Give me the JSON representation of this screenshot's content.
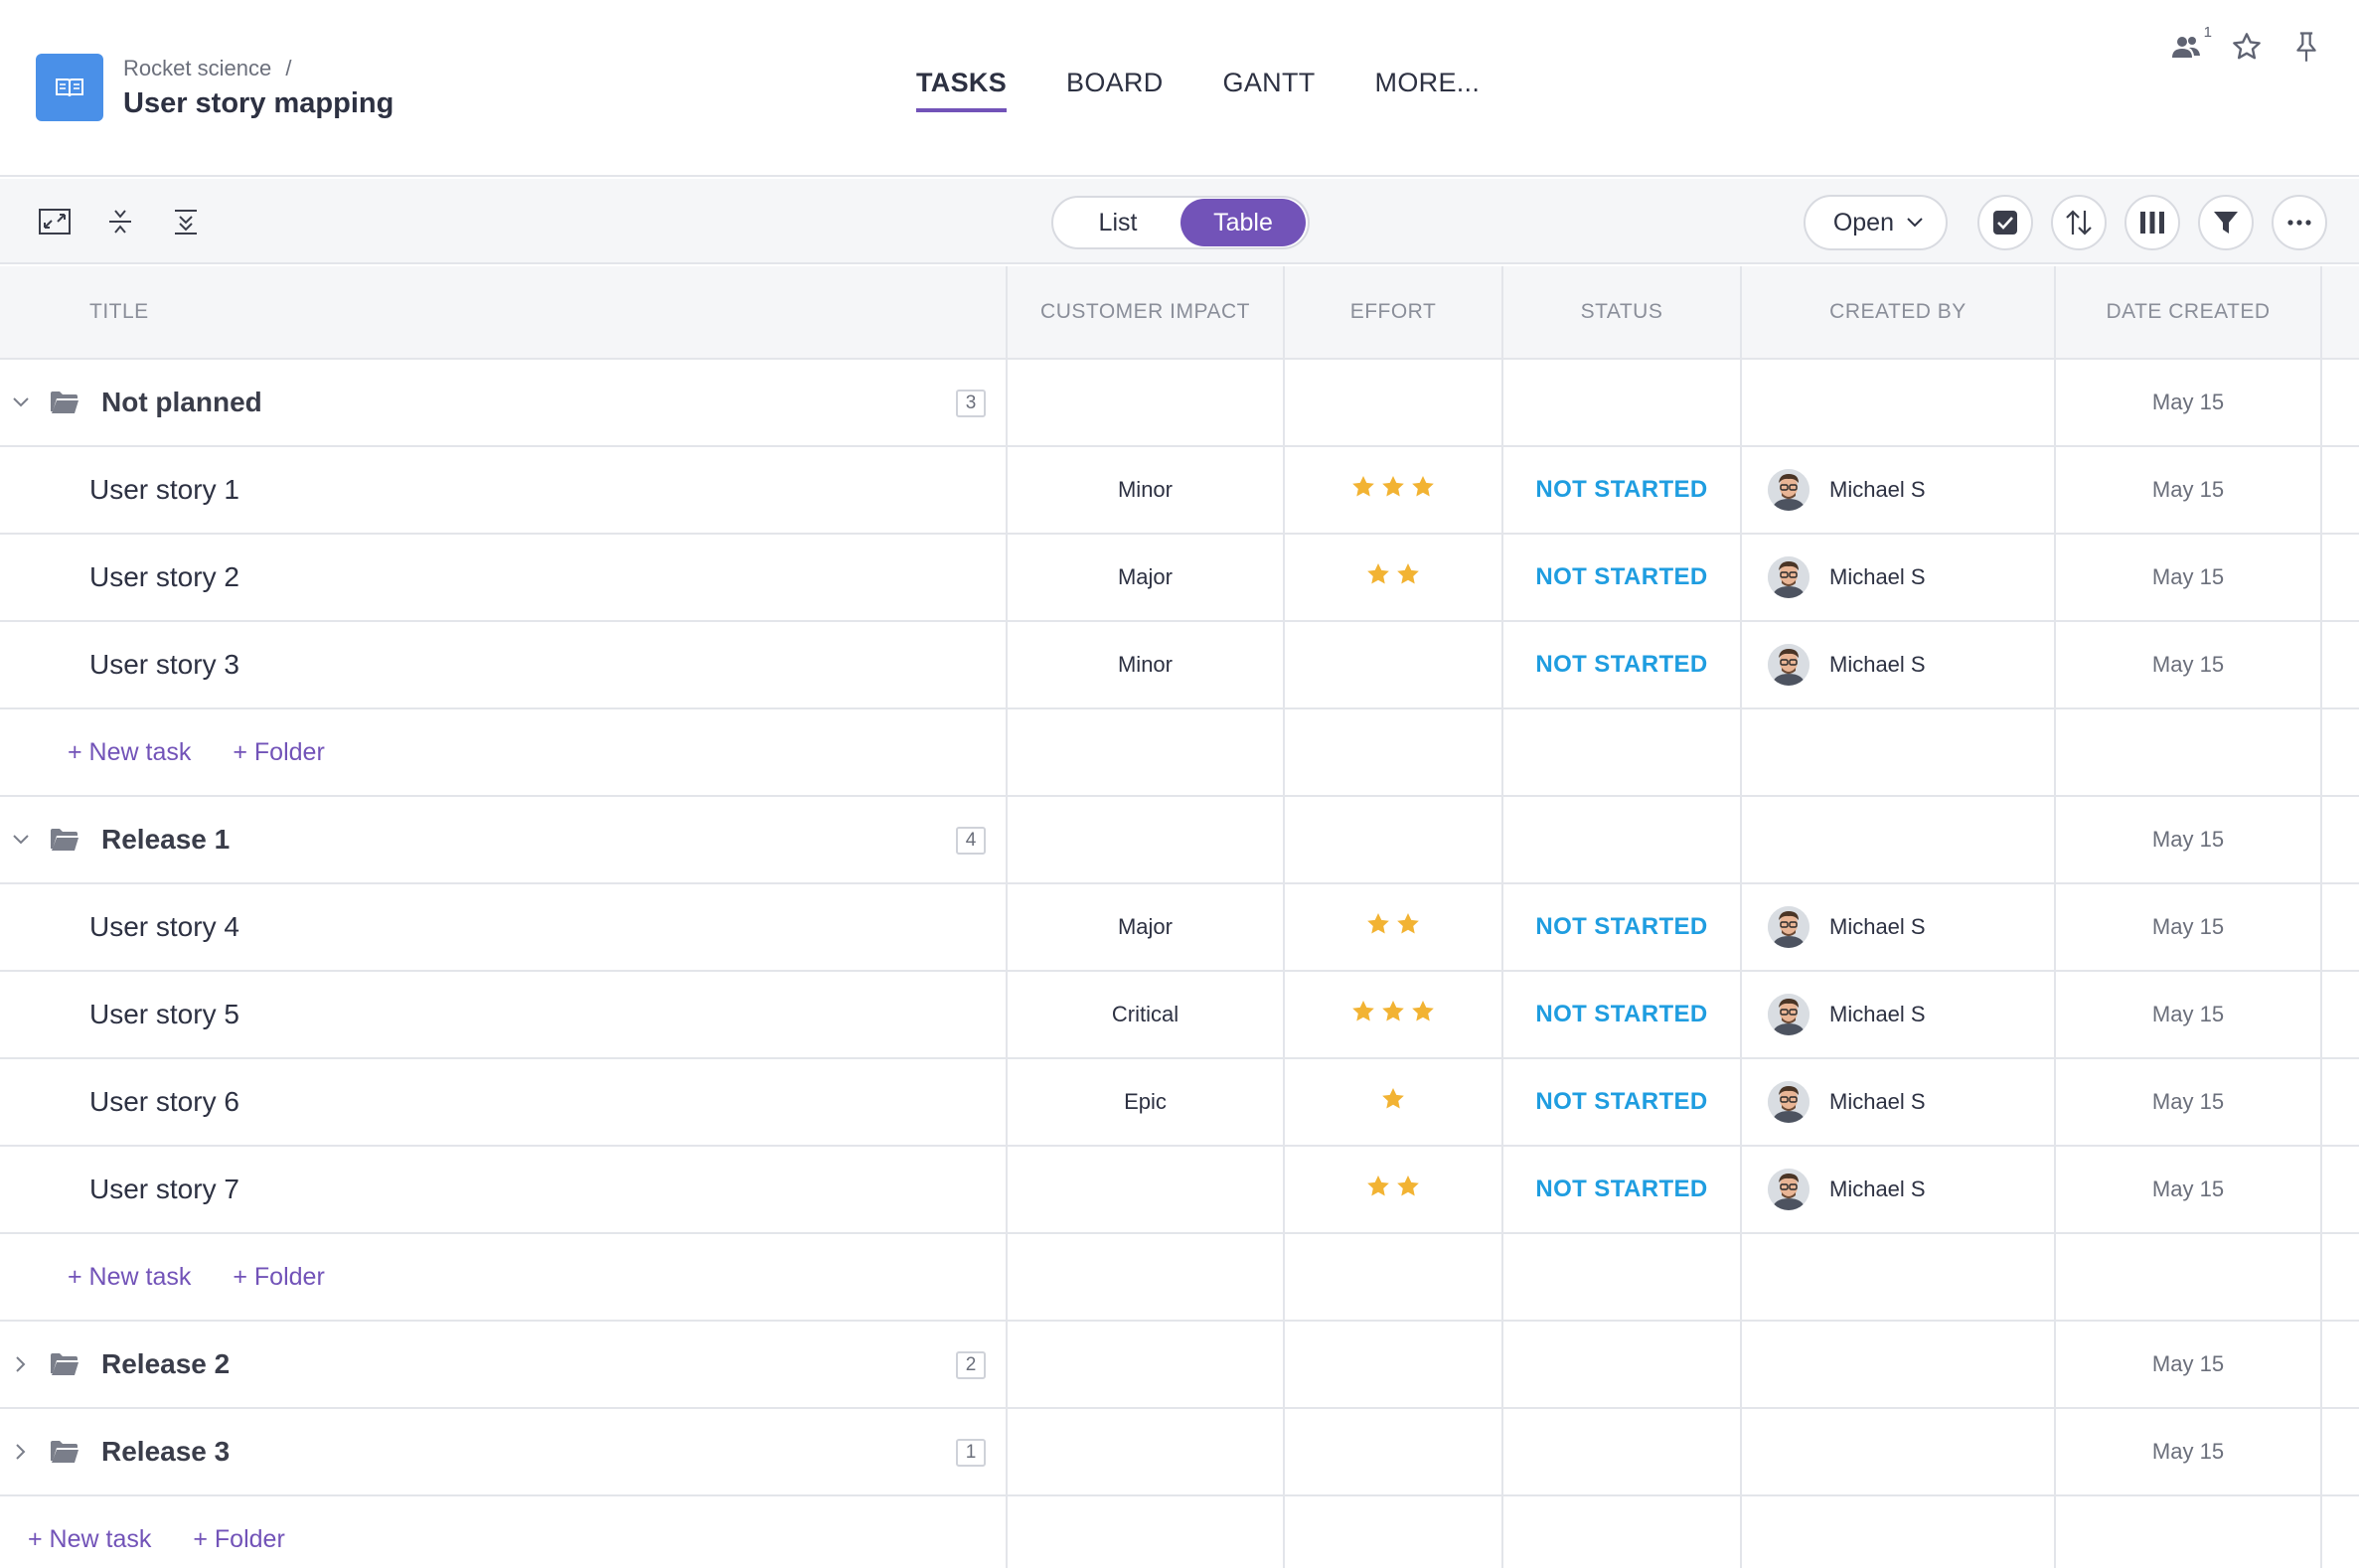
{
  "header": {
    "breadcrumb": "Rocket science",
    "breadcrumb_sep": "/",
    "title": "User story mapping",
    "tabs": [
      {
        "label": "TASKS",
        "active": true
      },
      {
        "label": "BOARD",
        "active": false
      },
      {
        "label": "GANTT",
        "active": false
      },
      {
        "label": "MORE..."
      }
    ],
    "members_count": "1"
  },
  "toolbar": {
    "view_toggle": {
      "list": "List",
      "table": "Table",
      "active": "Table"
    },
    "status_filter": "Open"
  },
  "columns": [
    "TITLE",
    "CUSTOMER IMPACT",
    "EFFORT",
    "STATUS",
    "CREATED BY",
    "DATE CREATED"
  ],
  "groups": [
    {
      "name": "Not planned",
      "count": "3",
      "expanded": true,
      "date": "May 15",
      "tasks": [
        {
          "title": "User story 1",
          "impact": "Minor",
          "effort": 3,
          "status": "NOT STARTED",
          "created_by": "Michael S",
          "date": "May 15"
        },
        {
          "title": "User story 2",
          "impact": "Major",
          "effort": 2,
          "status": "NOT STARTED",
          "created_by": "Michael S",
          "date": "May 15"
        },
        {
          "title": "User story 3",
          "impact": "Minor",
          "effort": 0,
          "status": "NOT STARTED",
          "created_by": "Michael S",
          "date": "May 15"
        }
      ]
    },
    {
      "name": "Release 1",
      "count": "4",
      "expanded": true,
      "date": "May 15",
      "tasks": [
        {
          "title": "User story 4",
          "impact": "Major",
          "effort": 2,
          "status": "NOT STARTED",
          "created_by": "Michael S",
          "date": "May 15"
        },
        {
          "title": "User story 5",
          "impact": "Critical",
          "effort": 3,
          "status": "NOT STARTED",
          "created_by": "Michael S",
          "date": "May 15"
        },
        {
          "title": "User story 6",
          "impact": "Epic",
          "effort": 1,
          "status": "NOT STARTED",
          "created_by": "Michael S",
          "date": "May 15"
        },
        {
          "title": "User story 7",
          "impact": "",
          "effort": 2,
          "status": "NOT STARTED",
          "created_by": "Michael S",
          "date": "May 15"
        }
      ]
    },
    {
      "name": "Release 2",
      "count": "2",
      "expanded": false,
      "date": "May 15",
      "tasks": []
    },
    {
      "name": "Release 3",
      "count": "1",
      "expanded": false,
      "date": "May 15",
      "tasks": []
    }
  ],
  "actions": {
    "new_task": "+ New task",
    "folder": "+ Folder"
  },
  "colors": {
    "accent": "#7253b8",
    "status_blue": "#1f9de0",
    "star": "#f2b333",
    "project_icon": "#4a90e8"
  }
}
